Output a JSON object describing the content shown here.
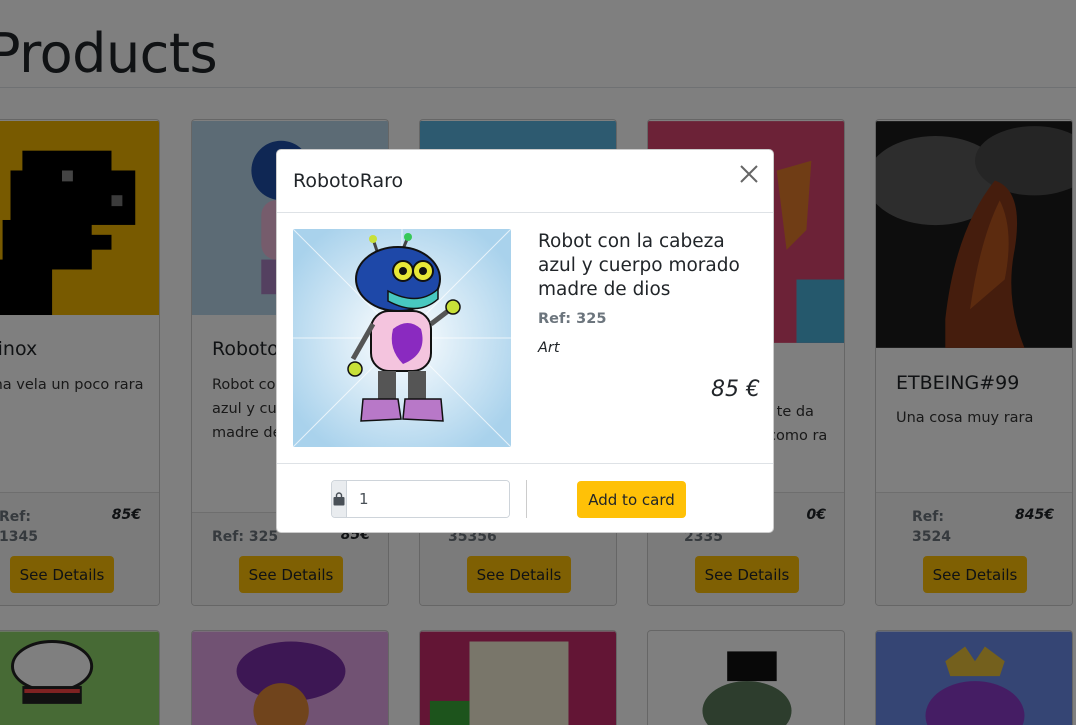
{
  "page": {
    "title": "Products"
  },
  "cards_row1": [
    {
      "title": "Dinox",
      "desc": "Una vela un poco rara",
      "ref_label": "Ref:",
      "ref": "1345",
      "price": "85€",
      "button": "See Details"
    },
    {
      "title": "RobotoRaro",
      "desc": "Robot con la cabeza azul y cuerpo morado madre de dios",
      "ref_label": "Ref:",
      "ref": "325",
      "price": "85€",
      "button": "See Details"
    },
    {
      "title": "",
      "desc": "",
      "ref_label": "",
      "ref": "35356",
      "price": "",
      "button": "See Details"
    },
    {
      "title": "",
      "desc": "l te da como ra",
      "ref_label": "",
      "ref": "2335",
      "price": "0€",
      "button": "See Details"
    },
    {
      "title": "ETBEING#99",
      "desc": "Una cosa muy rara",
      "ref_label": "Ref:",
      "ref": "3524",
      "price": "845€",
      "button": "See Details"
    }
  ],
  "modal": {
    "title": "RobotoRaro",
    "name": "Robot con la cabeza azul y cuerpo morado madre de dios",
    "ref": "Ref: 325",
    "category": "Art",
    "price": "85 €",
    "quantity": "1",
    "add_button": "Add to card",
    "close_icon": "close-icon",
    "qty_icon": "shopping-bag-icon"
  },
  "colors": {
    "accent": "#ffc107",
    "overlay": "rgba(0,0,0,0.5)"
  }
}
